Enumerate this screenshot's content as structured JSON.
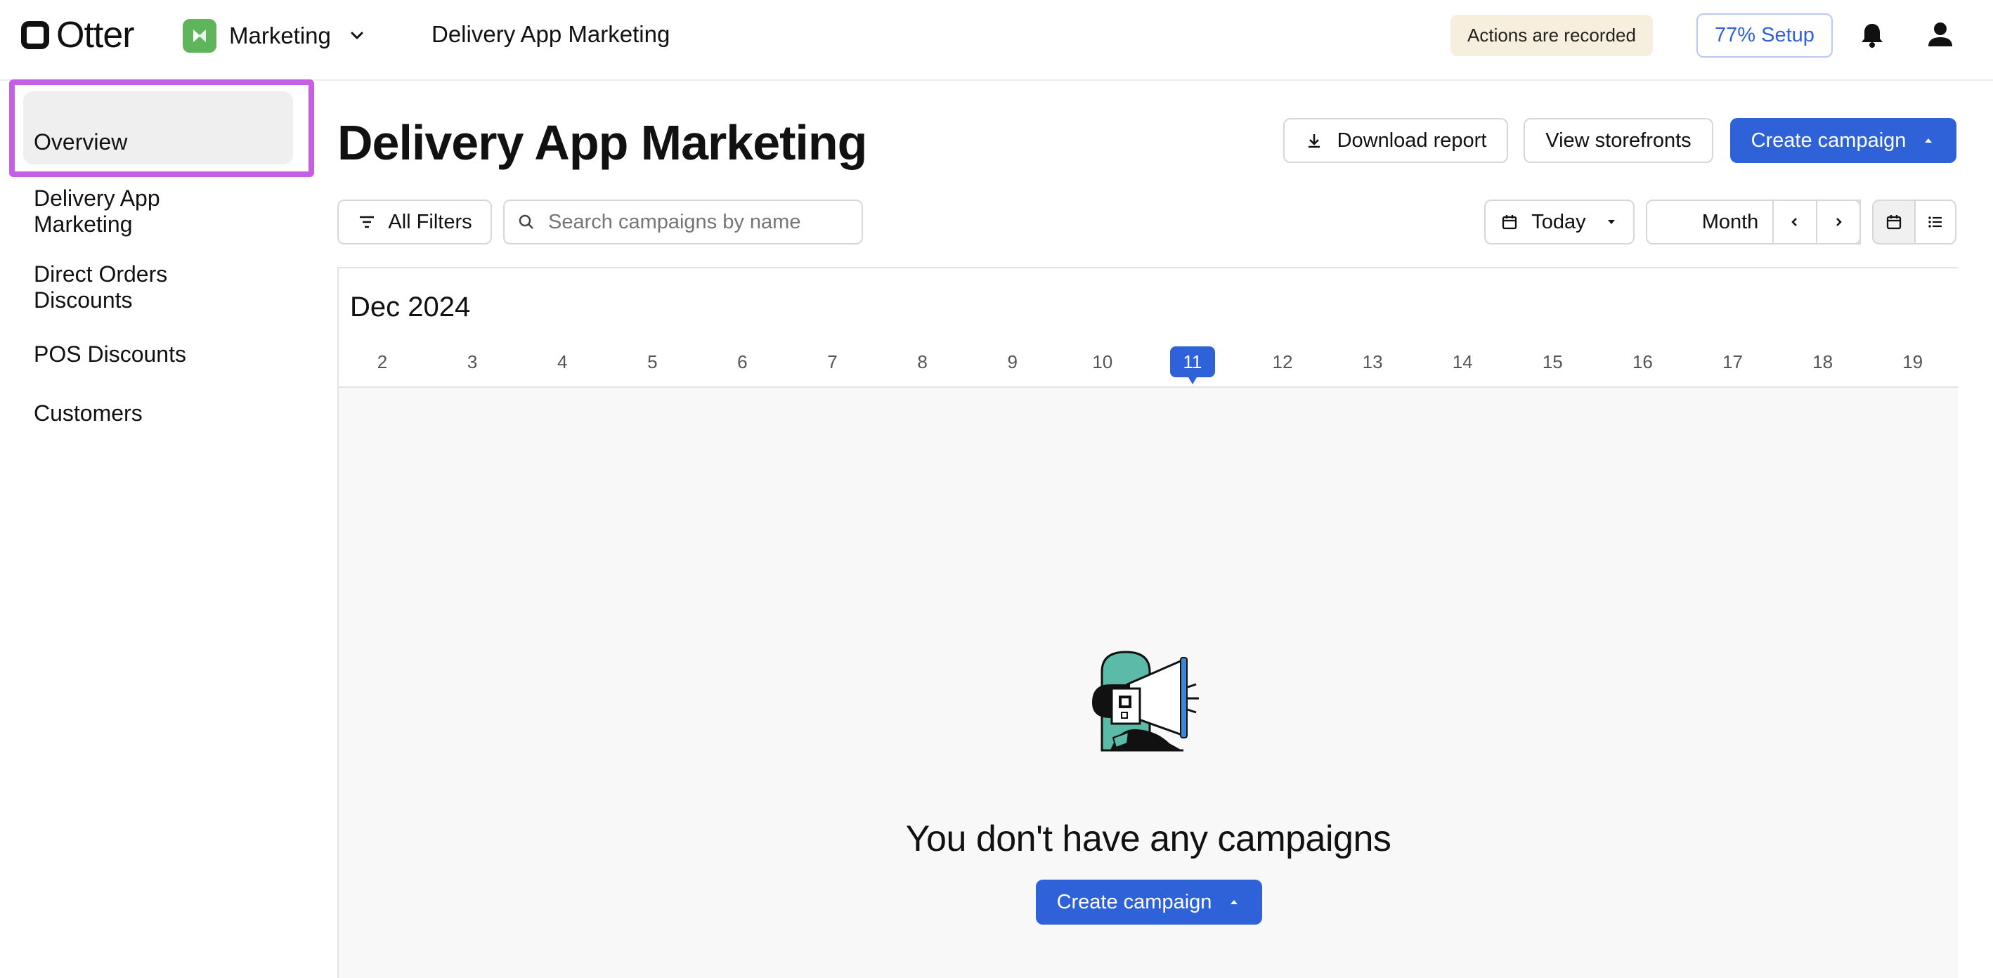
{
  "topbar": {
    "logo_text": "Otter",
    "app_name": "Marketing",
    "page_title": "Delivery App Marketing",
    "recorded_badge": "Actions are recorded",
    "setup_label": "77% Setup"
  },
  "sidebar": {
    "items": [
      {
        "label": "Overview"
      },
      {
        "label": "Delivery App Marketing",
        "active": true
      },
      {
        "label": "Direct Orders Discounts"
      },
      {
        "label": "POS Discounts"
      },
      {
        "label": "Customers"
      }
    ]
  },
  "header": {
    "title": "Delivery App Marketing",
    "download_label": "Download report",
    "storefronts_label": "View storefronts",
    "create_label": "Create campaign"
  },
  "toolbar": {
    "filters_label": "All Filters",
    "search_placeholder": "Search campaigns by name",
    "today_label": "Today",
    "period_label": "Month"
  },
  "calendar": {
    "month_label": "Dec 2024",
    "days": [
      "2",
      "3",
      "4",
      "5",
      "6",
      "7",
      "8",
      "9",
      "10",
      "11",
      "12",
      "13",
      "14",
      "15",
      "16",
      "17",
      "18",
      "19"
    ],
    "today": "11"
  },
  "empty_state": {
    "message": "You don't have any campaigns",
    "create_label": "Create campaign"
  },
  "colors": {
    "primary": "#2f62d8",
    "app_badge": "#5fb55c",
    "illustration_teal": "#5bbaa8",
    "highlight": "#c65ee6"
  }
}
